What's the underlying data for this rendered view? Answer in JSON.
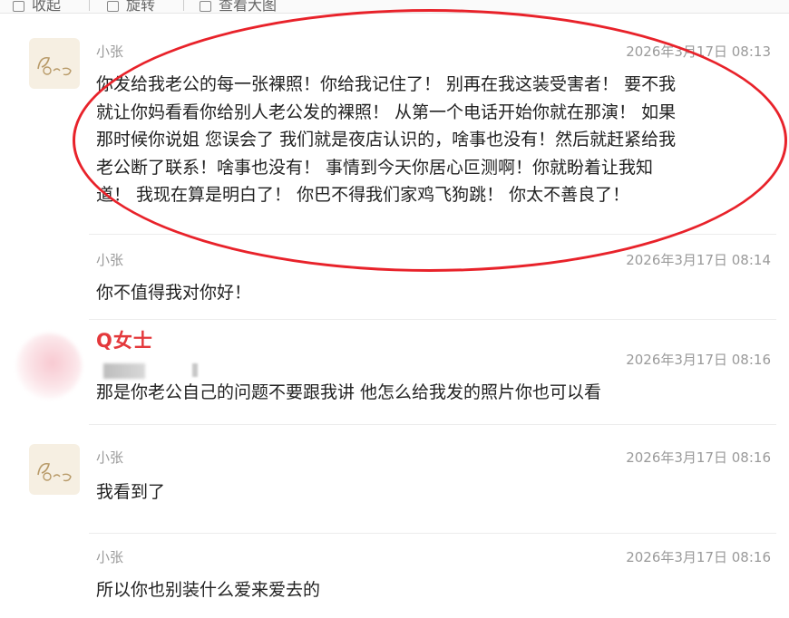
{
  "toolbar": {
    "items": [
      "收起",
      "旋转",
      "查看大图"
    ]
  },
  "messages": [
    {
      "sender": "小张",
      "time": "2026年3月17日 08:13",
      "lines": [
        "你发给我老公的每一张裸照！你给我记住了！ 别再在我这装受害者！ 要不我",
        "就让你妈看看你给别人老公发的裸照！ 从第一个电话开始你就在那演！ 如果",
        "那时候你说姐 您误会了 我们就是夜店认识的，啥事也没有！然后就赶紧给我",
        "老公断了联系！啥事也没有！ 事情到今天你居心叵测啊！你就盼着让我知",
        "道！ 我现在算是明白了！ 你巴不得我们家鸡飞狗跳！ 你太不善良了！"
      ]
    },
    {
      "sender": "小张",
      "time": "2026年3月17日 08:14",
      "text": "你不值得我对你好！"
    },
    {
      "sender": "Q女士",
      "time": "2026年3月17日 08:16",
      "text": "那是你老公自己的问题不要跟我讲 他怎么给我发的照片你也可以看"
    },
    {
      "sender": "小张",
      "time": "2026年3月17日 08:16",
      "text": "我看到了"
    },
    {
      "sender": "小张",
      "time": "2026年3月17日 08:16",
      "text": "所以你也别装什么爱来爱去的"
    }
  ],
  "colors": {
    "highlight_circle": "#e8222a",
    "q_sender": "#e4393c"
  },
  "icons": [
    "collapse-icon",
    "rotate-icon",
    "view-large-icon",
    "avatar-cartoon-icon"
  ]
}
